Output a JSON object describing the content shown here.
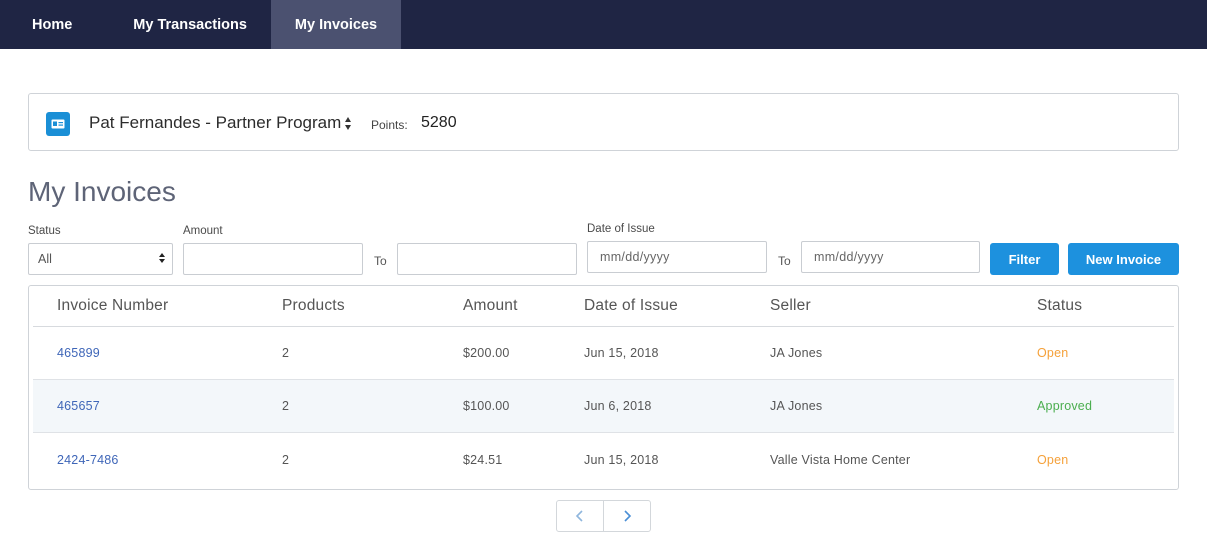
{
  "nav": {
    "items": [
      {
        "label": "Home"
      },
      {
        "label": "My Transactions"
      },
      {
        "label": "My Invoices"
      }
    ]
  },
  "account": {
    "name": "Pat Fernandes - Partner Program",
    "points_label": "Points:",
    "points_value": "5280",
    "icon": "contact-card-icon"
  },
  "page": {
    "title": "My Invoices"
  },
  "filters": {
    "status_label": "Status",
    "status_value": "All",
    "amount_label": "Amount",
    "to_label": "To",
    "date_label": "Date of Issue",
    "date_from_placeholder": "mm/dd/yyyy",
    "date_to_placeholder": "mm/dd/yyyy",
    "filter_button": "Filter",
    "new_invoice_button": "New Invoice"
  },
  "table": {
    "columns": [
      "Invoice Number",
      "Products",
      "Amount",
      "Date of Issue",
      "Seller",
      "Status"
    ],
    "rows": [
      {
        "invoice": "465899",
        "products": "2",
        "amount": "$200.00",
        "date": "Jun 15, 2018",
        "seller": "JA Jones",
        "status": "Open"
      },
      {
        "invoice": "465657",
        "products": "2",
        "amount": "$100.00",
        "date": "Jun 6, 2018",
        "seller": "JA Jones",
        "status": "Approved"
      },
      {
        "invoice": "2424-7486",
        "products": "2",
        "amount": "$24.51",
        "date": "Jun 15, 2018",
        "seller": "Valle Vista Home Center",
        "status": "Open"
      }
    ]
  },
  "colors": {
    "nav_bg": "#1f2544",
    "nav_active": "#4b5170",
    "accent": "#1d91de",
    "link": "#3f66b8",
    "status_open": "#f5a13a",
    "status_approved": "#4bae4f"
  },
  "pagination": {
    "prev_icon": "chevron-left-icon",
    "next_icon": "chevron-right-icon"
  }
}
